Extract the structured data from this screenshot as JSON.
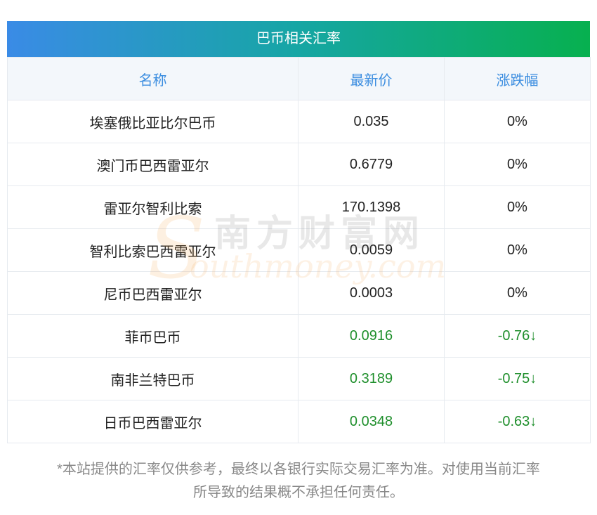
{
  "title": "巴币相关汇率",
  "headers": [
    "名称",
    "最新价",
    "涨跌幅"
  ],
  "rows": [
    {
      "name": "埃塞俄比亚比尔巴币",
      "price": "0.035",
      "change": "0%"
    },
    {
      "name": "澳门币巴西雷亚尔",
      "price": "0.6779",
      "change": "0%"
    },
    {
      "name": "雷亚尔智利比索",
      "price": "170.1398",
      "change": "0%"
    },
    {
      "name": "智利比索巴西雷亚尔",
      "price": "0.0059",
      "change": "0%"
    },
    {
      "name": "尼币巴西雷亚尔",
      "price": "0.0003",
      "change": "0%"
    },
    {
      "name": "菲币巴币",
      "price": "0.0916",
      "change": "-0.76↓"
    },
    {
      "name": "南非兰特巴币",
      "price": "0.3189",
      "change": "-0.75↓"
    },
    {
      "name": "日币巴西雷亚尔",
      "price": "0.0348",
      "change": "-0.63↓"
    }
  ],
  "watermark": {
    "cn": "南方财富网",
    "letter": "S",
    "en": "outhmoney.com"
  },
  "disclaimer": [
    "*本站提供的汇率仅供参考，最终以各银行实际交易汇率为准。对使用当前汇率",
    "所导致的结果概不承担任何责任。"
  ],
  "colors": {
    "header_text": "#3c8ee0",
    "down": "#1f8f2c",
    "title_grad_start": "#3a8be6",
    "title_grad_end": "#07b04f"
  }
}
